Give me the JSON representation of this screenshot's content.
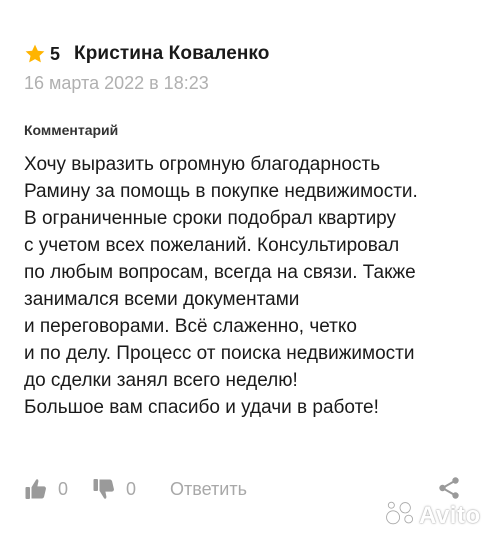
{
  "review": {
    "rating": "5",
    "author": "Кристина Коваленко",
    "date": "16 марта 2022 в 18:23",
    "comment_label": "Комментарий",
    "lines": [
      "Хочу выразить огромную благодарность",
      "Рамину за помощь в покупке недвижимости.",
      "В ограниченные сроки подобрал квартиру",
      "с учетом всех пожеланий. Консультировал",
      "по любым вопросам, всегда на связи. Также",
      "занимался всеми документами",
      "и переговорами. Всё слаженно, четко",
      "и по делу. Процесс от поиска недвижимости",
      "до сделки занял всего неделю!",
      "Большое вам спасибо и удачи в работе!"
    ]
  },
  "actions": {
    "like_count": "0",
    "dislike_count": "0",
    "reply_label": "Ответить"
  },
  "watermark": {
    "brand": "Avito"
  },
  "colors": {
    "star": "#ffb400",
    "muted": "#a8a8a8",
    "icon": "#9a9a9a"
  },
  "icons": [
    "star-icon",
    "thumbs-up-icon",
    "thumbs-down-icon",
    "share-icon",
    "avito-logo-icon"
  ]
}
